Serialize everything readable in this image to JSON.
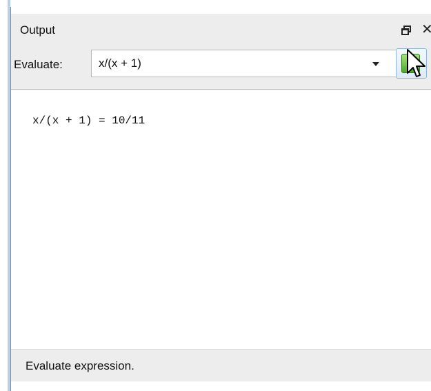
{
  "panel": {
    "title": "Output",
    "float_icon": "float-window-icon",
    "close_icon": "close-icon",
    "close_glyph": "✕"
  },
  "toolbar": {
    "evaluate_label": "Evaluate:",
    "expression_value": "x/(x + 1)",
    "dropdown_icon": "chevron-down-icon",
    "evaluate_button_icon": "exclamation-icon",
    "evaluate_button_glyph": "!"
  },
  "output": {
    "lines": [
      "x/(x + 1) = 10/11"
    ]
  },
  "status": {
    "text": "Evaluate expression."
  },
  "colors": {
    "panel_bg": "#ededed",
    "accent": "#b8d0ea",
    "button_green": "#4ca72a"
  }
}
